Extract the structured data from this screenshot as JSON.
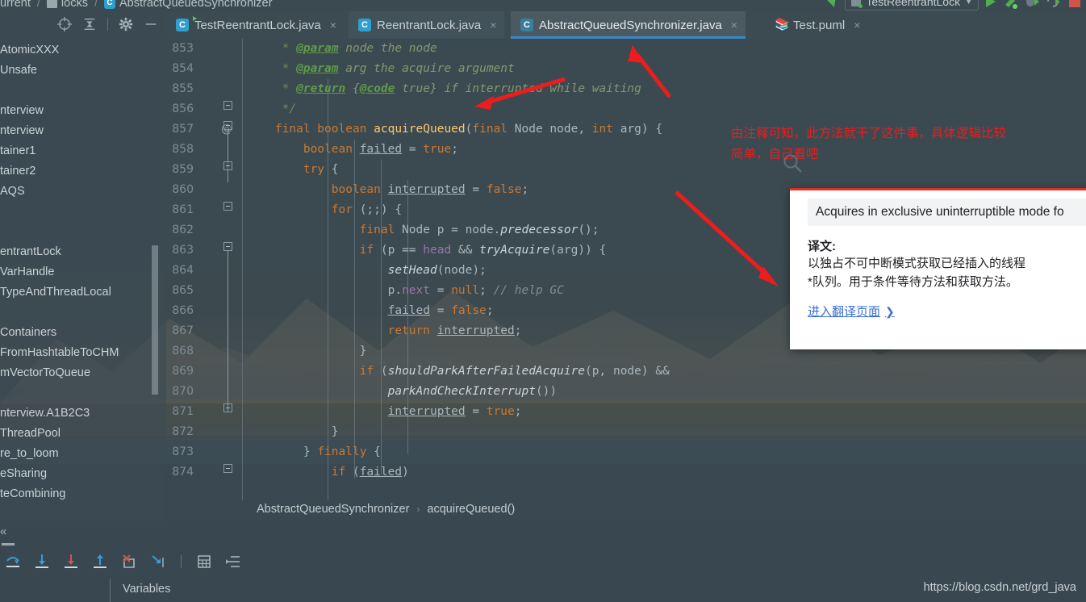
{
  "breadcrumb_top": {
    "items": [
      "urrent",
      "locks",
      "AbstractQueuedSynchronizer"
    ]
  },
  "left_toolbar": {
    "icons": [
      "locate-icon",
      "collapse-all-icon",
      "settings-gear-icon",
      "minimize-icon"
    ]
  },
  "project_tree": {
    "items": [
      "AtomicXXX",
      "Unsafe",
      "",
      "nterview",
      "nterview",
      "tainer1",
      "tainer2",
      "AQS",
      "",
      "",
      "entrantLock",
      "VarHandle",
      "TypeAndThreadLocal",
      "",
      "Containers",
      "FromHashtableToCHM",
      "mVectorToQueue",
      "",
      "nterview.A1B2C3",
      "ThreadPool",
      "re_to_loom",
      "eSharing",
      "teCombining"
    ]
  },
  "tabs": [
    {
      "label": "TestReentrantLock.java",
      "icon": "java-test-class-icon",
      "active": false,
      "close": "×"
    },
    {
      "label": "ReentrantLock.java",
      "icon": "java-class-icon",
      "active": false,
      "close": "×"
    },
    {
      "label": "AbstractQueuedSynchronizer.java",
      "icon": "java-class-readonly-icon",
      "active": true,
      "close": "×"
    },
    {
      "label": "Test.puml",
      "icon": "puml-file-icon",
      "active": false,
      "close": "×"
    }
  ],
  "run_toolbar": {
    "config_name": "TestReentrantLock",
    "dropdown_caret": "▼",
    "buttons": [
      "run-icon",
      "build-icon",
      "debug-icon",
      "rerun-debug-icon",
      "stop-icon"
    ]
  },
  "editor": {
    "first_line": 853,
    "lines": [
      {
        "n": 853,
        "at": false
      },
      {
        "n": 854,
        "at": false
      },
      {
        "n": 855,
        "at": false
      },
      {
        "n": 856,
        "at": false
      },
      {
        "n": 857,
        "at": true
      },
      {
        "n": 858,
        "at": false
      },
      {
        "n": 859,
        "at": false
      },
      {
        "n": 860,
        "at": false
      },
      {
        "n": 861,
        "at": false
      },
      {
        "n": 862,
        "at": false
      },
      {
        "n": 863,
        "at": false
      },
      {
        "n": 864,
        "at": false
      },
      {
        "n": 865,
        "at": false
      },
      {
        "n": 866,
        "at": false
      },
      {
        "n": 867,
        "at": false
      },
      {
        "n": 868,
        "at": false
      },
      {
        "n": 869,
        "at": false
      },
      {
        "n": 870,
        "at": false
      },
      {
        "n": 871,
        "at": false
      },
      {
        "n": 872,
        "at": false
      },
      {
        "n": 873,
        "at": false
      },
      {
        "n": 874,
        "at": false
      }
    ],
    "source_text": [
      "     * @param node the node",
      "     * @param arg the acquire argument",
      "     * @return {@code true} if interrupted while waiting",
      "     */",
      "    final boolean acquireQueued(final Node node, int arg) {",
      "        boolean failed = true;",
      "        try {",
      "            boolean interrupted = false;",
      "            for (;;) {",
      "                final Node p = node.predecessor();",
      "                if (p == head && tryAcquire(arg)) {",
      "                    setHead(node);",
      "                    p.next = null; // help GC",
      "                    failed = false;",
      "                    return interrupted;",
      "                }",
      "                if (shouldParkAfterFailedAcquire(p, node) &&",
      "                    parkAndCheckInterrupt())",
      "                    interrupted = true;",
      "            }",
      "        } finally {",
      "            if (failed)"
    ]
  },
  "editor_breadcrumb": {
    "class": "AbstractQueuedSynchronizer",
    "separator": "›",
    "method": "acquireQueued()"
  },
  "debug_toolbar": {
    "buttons": [
      "step-over-icon",
      "step-into-icon",
      "force-step-into-icon",
      "step-out-icon",
      "drop-frame-icon",
      "run-to-cursor-icon",
      "evaluate-expression-icon",
      "show-execution-point-icon"
    ]
  },
  "bottom": {
    "variables_label": "Variables",
    "watermark": "https://blog.csdn.net/grd_java"
  },
  "annotation": {
    "text": "由注释可知，此方法就干了这件事，具体逻辑比较\n简单，自己看吧",
    "color": "#ee1c1c",
    "arrows": 2
  },
  "translate_popup": {
    "source": "Acquires in exclusive uninterruptible mode fo",
    "label": "译文:",
    "translation": "以独占不可中断模式获取已经插入的线程\n*队列。用于条件等待方法和获取方法。",
    "link": "进入翻译页面",
    "link_chevron": "›",
    "accent": "#d93025"
  },
  "colors": {
    "editor_bg": "#3b4a51",
    "tab_active_bg": "#4b5a61",
    "tab_accent": "#3b86c7",
    "keyword": "#cb7832",
    "method": "#ffc66d",
    "comment": "#6f8a5c",
    "field": "#9876aa",
    "text": "#a9b7bd"
  }
}
